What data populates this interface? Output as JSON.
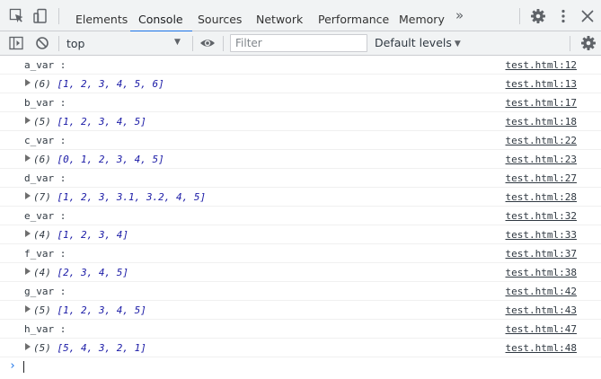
{
  "tabs": [
    "Elements",
    "Console",
    "Sources",
    "Network",
    "Performance",
    "Memory"
  ],
  "active_tab": "Console",
  "more_tabs_label": "»",
  "toolbar": {
    "context": "top",
    "filter_placeholder": "Filter",
    "levels_label": "Default levels"
  },
  "colors": {
    "accent": "#1a73e8",
    "array_text": "#1a1aa6",
    "toolbar_bg": "#f1f3f4"
  },
  "messages": [
    {
      "type": "text",
      "text": "a_var :",
      "source": "test.html:12"
    },
    {
      "type": "array",
      "count": "(6)",
      "value": "[1, 2, 3, 4, 5, 6]",
      "source": "test.html:13"
    },
    {
      "type": "text",
      "text": "b_var :",
      "source": "test.html:17"
    },
    {
      "type": "array",
      "count": "(5)",
      "value": "[1, 2, 3, 4, 5]",
      "source": "test.html:18"
    },
    {
      "type": "text",
      "text": "c_var :",
      "source": "test.html:22"
    },
    {
      "type": "array",
      "count": "(6)",
      "value": "[0, 1, 2, 3, 4, 5]",
      "source": "test.html:23"
    },
    {
      "type": "text",
      "text": "d_var :",
      "source": "test.html:27"
    },
    {
      "type": "array",
      "count": "(7)",
      "value": "[1, 2, 3, 3.1, 3.2, 4, 5]",
      "source": "test.html:28"
    },
    {
      "type": "text",
      "text": "e_var :",
      "source": "test.html:32"
    },
    {
      "type": "array",
      "count": "(4)",
      "value": "[1, 2, 3, 4]",
      "source": "test.html:33"
    },
    {
      "type": "text",
      "text": "f_var :",
      "source": "test.html:37"
    },
    {
      "type": "array",
      "count": "(4)",
      "value": "[2, 3, 4, 5]",
      "source": "test.html:38"
    },
    {
      "type": "text",
      "text": "g_var :",
      "source": "test.html:42"
    },
    {
      "type": "array",
      "count": "(5)",
      "value": "[1, 2, 3, 4, 5]",
      "source": "test.html:43"
    },
    {
      "type": "text",
      "text": "h_var :",
      "source": "test.html:47"
    },
    {
      "type": "array",
      "count": "(5)",
      "value": "[5, 4, 3, 2, 1]",
      "source": "test.html:48"
    }
  ]
}
